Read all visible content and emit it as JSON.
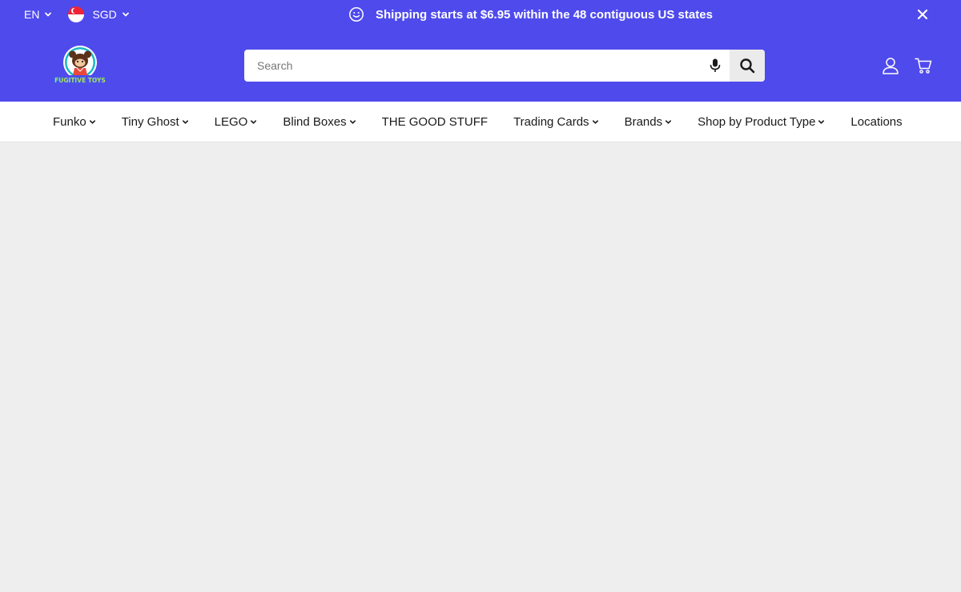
{
  "topbar": {
    "language": {
      "label": "EN",
      "icon": "chevron-down-icon"
    },
    "currency": {
      "label": "SGD",
      "flag": "singapore-flag-icon",
      "icon": "chevron-down-icon"
    },
    "announcement": {
      "icon": "smiley-icon",
      "text": "Shipping starts at $6.95 within the 48 contiguous US states"
    },
    "close_icon": "close-icon"
  },
  "header": {
    "logo": {
      "text": "FUGITIVE TOYS"
    },
    "search": {
      "placeholder": "Search",
      "value": ""
    },
    "icons": [
      "microphone-icon",
      "search-icon",
      "account-icon",
      "cart-icon"
    ]
  },
  "nav": {
    "items": [
      {
        "label": "Funko",
        "dropdown": true
      },
      {
        "label": "Tiny Ghost",
        "dropdown": true
      },
      {
        "label": "LEGO",
        "dropdown": true
      },
      {
        "label": "Blind Boxes",
        "dropdown": true
      },
      {
        "label": "THE GOOD STUFF",
        "dropdown": false
      },
      {
        "label": "Trading Cards",
        "dropdown": true
      },
      {
        "label": "Brands",
        "dropdown": true
      },
      {
        "label": "Shop by Product Type",
        "dropdown": true
      },
      {
        "label": "Locations",
        "dropdown": false
      }
    ]
  },
  "colors": {
    "header_bg": "#4f4aec",
    "nav_bg": "#ffffff",
    "content_bg": "#eeeeef",
    "text_dark": "#1a1a1a"
  }
}
